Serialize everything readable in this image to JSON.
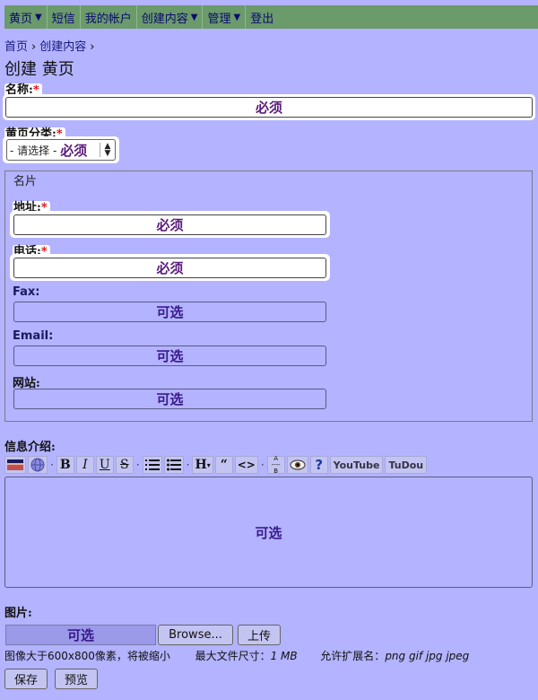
{
  "nav": [
    {
      "label": "黄页",
      "dropdown": true
    },
    {
      "label": "短信",
      "dropdown": false
    },
    {
      "label": "我的帐户",
      "dropdown": false
    },
    {
      "label": "创建内容",
      "dropdown": true
    },
    {
      "label": "管理",
      "dropdown": true
    },
    {
      "label": "登出",
      "dropdown": false
    }
  ],
  "breadcrumb": {
    "home": "首页",
    "create": "创建内容",
    "sep": "›"
  },
  "page_title": "创建 黄页",
  "required_mark": "*",
  "required_placeholder": "必须",
  "optional_placeholder": "可选",
  "fields": {
    "name_label": "名称:",
    "category_label": "黄页分类:",
    "category_select": "- 请选择 -",
    "card_legend": "名片",
    "address_label": "地址:",
    "phone_label": "电话:",
    "fax_label": "Fax:",
    "email_label": "Email:",
    "website_label": "网站:",
    "intro_label": "信息介绍:",
    "image_label": "图片:"
  },
  "toolbar": {
    "bold": "B",
    "italic": "I",
    "underline": "U",
    "strike": "S",
    "heading": "H",
    "quote": "“",
    "code": "<>",
    "youtube": "YouTube",
    "tudou": "TuDou"
  },
  "upload": {
    "browse": "Browse...",
    "upload": "上传",
    "help_size": "图像大于600x800像素，将被缩小",
    "help_max_label": "最大文件尺寸：",
    "help_max_value": "1 MB",
    "help_ext_label": "允许扩展名：",
    "help_ext_value": "png gif jpg jpeg"
  },
  "actions": {
    "save": "保存",
    "preview": "预览"
  }
}
